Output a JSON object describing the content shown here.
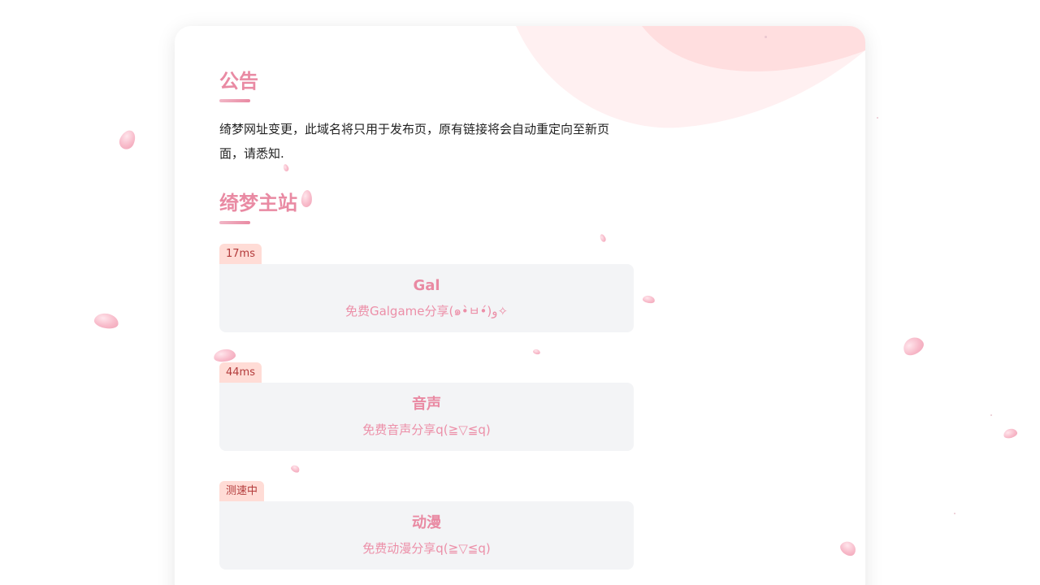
{
  "notice": {
    "title": "公告",
    "text": "绮梦网址变更，此域名将只用于发布页，原有链接将会自动重定向至新页面，请悉知."
  },
  "main_sites": {
    "title": "绮梦主站",
    "items": [
      {
        "latency": "17ms",
        "name": "Gal",
        "description": "免费Galgame分享(๑•̀ㅂ•́)و✧"
      },
      {
        "latency": "44ms",
        "name": "音声",
        "description": "免费音声分享q(≧▽≦q)"
      },
      {
        "latency": "测速中",
        "name": "动漫",
        "description": "免费动漫分享q(≧▽≦q)"
      }
    ]
  },
  "colors": {
    "accent": "#e98aa3",
    "tag_background": "#ffdcd6",
    "tag_text": "#b33b3b",
    "box_background": "#f3f4f6"
  }
}
